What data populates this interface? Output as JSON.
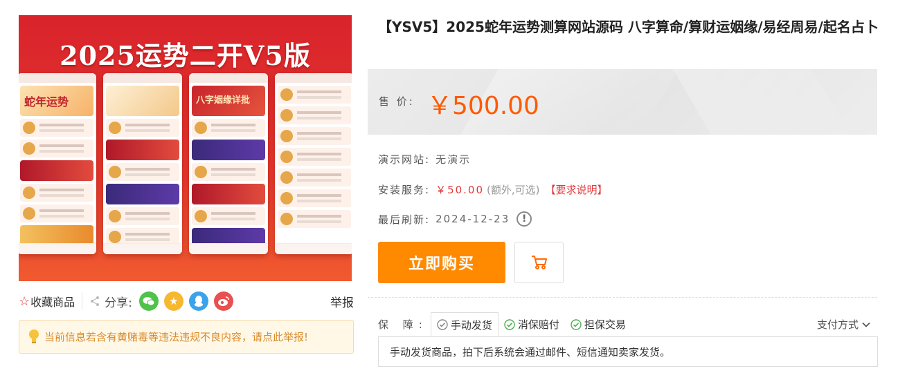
{
  "image": {
    "banner_title": "2025运势二开V5版",
    "phone_hero_texts": [
      "蛇年运势",
      "",
      "八字姻缘详批",
      ""
    ]
  },
  "actions": {
    "favorite_label": "收藏商品",
    "share_label": "分享:",
    "report_label": "举报",
    "social_icons": [
      "wechat-icon",
      "qzone-icon",
      "qq-icon",
      "weibo-icon"
    ]
  },
  "notice": {
    "text": "当前信息若含有黄赌毒等违法违规不良内容，请点此举报!"
  },
  "product": {
    "title": "【YSV5】2025蛇年运势测算网站源码 八字算命/算财运姻缘/易经周易/起名占卜",
    "price_label": "售  价:",
    "price": "￥500.00",
    "demo_label": "演示网站:",
    "demo_value": "无演示",
    "install_label": "安装服务:",
    "install_price": "￥50.00",
    "install_extra": "(额外,可选)",
    "install_requirement": "【要求说明】",
    "refresh_label": "最后刷新:",
    "refresh_date": "2024-12-23",
    "info_icon_symbol": "!"
  },
  "buttons": {
    "buy_label": "立即购买"
  },
  "guarantee": {
    "label": "保  障:",
    "items": [
      "手动发货",
      "消保赔付",
      "担保交易"
    ],
    "pay_label": "支付方式",
    "description": "手动发货商品，拍下后系统会通过邮件、短信通知卖家发货。"
  },
  "colors": {
    "accent_orange": "#ff8a00",
    "price_orange": "#ff5a00",
    "alert_red": "#e4393c",
    "notice_text": "#d98a2b"
  }
}
